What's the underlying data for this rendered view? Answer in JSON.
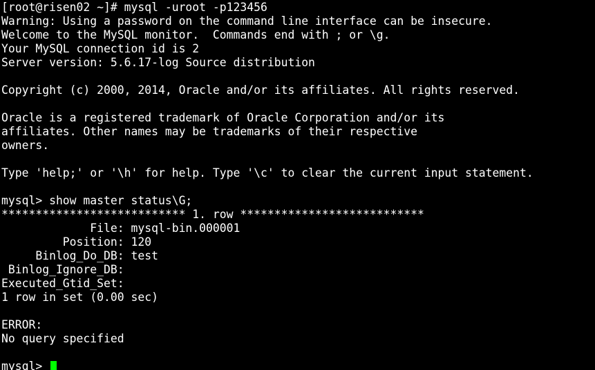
{
  "terminal": {
    "lines": [
      "[root@risen02 ~]# mysql -uroot -p123456",
      "Warning: Using a password on the command line interface can be insecure.",
      "Welcome to the MySQL monitor.  Commands end with ; or \\g.",
      "Your MySQL connection id is 2",
      "Server version: 5.6.17-log Source distribution",
      "",
      "Copyright (c) 2000, 2014, Oracle and/or its affiliates. All rights reserved.",
      "",
      "Oracle is a registered trademark of Oracle Corporation and/or its",
      "affiliates. Other names may be trademarks of their respective",
      "owners.",
      "",
      "Type 'help;' or '\\h' for help. Type '\\c' to clear the current input statement.",
      "",
      "mysql> show master status\\G;",
      "*************************** 1. row ***************************",
      "             File: mysql-bin.000001",
      "         Position: 120",
      "     Binlog_Do_DB: test",
      " Binlog_Ignore_DB:",
      "Executed_Gtid_Set:",
      "1 row in set (0.00 sec)",
      "",
      "ERROR:",
      "No query specified",
      ""
    ],
    "prompt": "mysql> ",
    "colors": {
      "background": "#000000",
      "text": "#ffffff",
      "cursor": "#00ff00"
    }
  }
}
